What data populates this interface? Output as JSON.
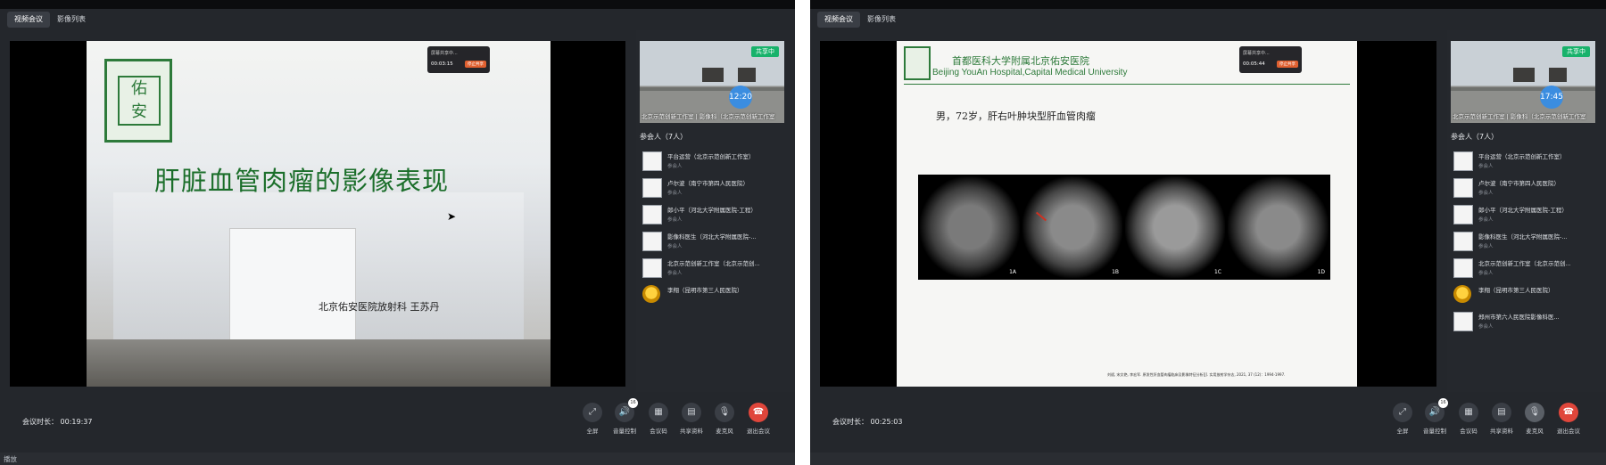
{
  "left": {
    "tabs": [
      "视频会议",
      "影像列表"
    ],
    "slide": {
      "title": "肝脏血管肉瘤的影像表现",
      "author": "北京佑安医院放射科 王苏丹"
    },
    "overlay": {
      "title": "屏幕共享中...",
      "time": "00:03:15",
      "button": "停止共享"
    },
    "camera": {
      "badge": "共享中",
      "clock": "12:20",
      "caption": "北京示范创新工作室 | 影像科（北京示范创新工作室"
    },
    "participants_header": "参会人（7人）",
    "participants": [
      {
        "name": "平台运营（北京示范创新工作室）",
        "role": "参会人"
      },
      {
        "name": "卢尔波（南宁市第四人民医院）",
        "role": "参会人"
      },
      {
        "name": "郎小平（河北大学附属医院-工程）",
        "role": "参会人"
      },
      {
        "name": "影像科医生（河北大学附属医院-...",
        "role": "参会人"
      },
      {
        "name": "北京示范创新工作室（北京示范创...",
        "role": "参会人"
      },
      {
        "name": "李翔（昆明市第三人民医院）",
        "role": ""
      }
    ],
    "duration": "会议时长： 00:19:37",
    "controls": [
      {
        "label": "全屏",
        "icon": "fullscreen-icon",
        "glyph": "⤢"
      },
      {
        "label": "音量控制",
        "icon": "volume-icon",
        "glyph": "🔊",
        "badge": "16"
      },
      {
        "label": "会议码",
        "icon": "qrcode-icon",
        "glyph": "▦"
      },
      {
        "label": "共享资料",
        "icon": "document-icon",
        "glyph": "▤"
      },
      {
        "label": "麦克风",
        "icon": "microphone-icon",
        "glyph": "🎙"
      },
      {
        "label": "退出会议",
        "icon": "hangup-icon",
        "glyph": "☎"
      }
    ],
    "status": "播放"
  },
  "right": {
    "tabs": [
      "视频会议",
      "影像列表"
    ],
    "slide": {
      "hospital_cn": "首都医科大学附属北京佑安医院",
      "hospital_en": "Beijing YouAn Hospital,Capital Medical University",
      "case": "男，72岁，肝右叶肿块型肝血管肉瘤",
      "panels": [
        "1A",
        "1B",
        "1C",
        "1D"
      ],
      "footnote": "刘斌, 宋文艳, 李宏军. 原发性肝血管肉瘤临床及影像特征分析[J]. 实用放射学杂志, 2021, 37 (12)：1994-1997."
    },
    "overlay": {
      "title": "屏幕共享中...",
      "time": "00:05:44",
      "button": "停止共享"
    },
    "camera": {
      "badge": "共享中",
      "clock": "17:45",
      "caption": "北京示范创新工作室 | 影像科（北京示范创新工作室"
    },
    "participants_header": "参会人（7人）",
    "participants": [
      {
        "name": "平台运营（北京示范创新工作室）",
        "role": "参会人"
      },
      {
        "name": "卢尔波（南宁市第四人民医院）",
        "role": "参会人"
      },
      {
        "name": "郎小平（河北大学附属医院-工程）",
        "role": "参会人"
      },
      {
        "name": "影像科医生（河北大学附属医院-...",
        "role": "参会人"
      },
      {
        "name": "北京示范创新工作室（北京示范创...",
        "role": "参会人"
      },
      {
        "name": "李翔（昆明市第三人民医院）",
        "role": ""
      },
      {
        "name": "郑州市第六人民医院影像科医...",
        "role": "参会人"
      }
    ],
    "duration": "会议时长： 00:25:03",
    "controls": [
      {
        "label": "全屏",
        "icon": "fullscreen-icon",
        "glyph": "⤢"
      },
      {
        "label": "音量控制",
        "icon": "volume-icon",
        "glyph": "🔊",
        "badge": "16"
      },
      {
        "label": "会议码",
        "icon": "qrcode-icon",
        "glyph": "▦"
      },
      {
        "label": "共享资料",
        "icon": "document-icon",
        "glyph": "▤"
      },
      {
        "label": "麦克风",
        "icon": "microphone-icon",
        "glyph": "🎙"
      },
      {
        "label": "退出会议",
        "icon": "hangup-icon",
        "glyph": "☎"
      }
    ]
  }
}
